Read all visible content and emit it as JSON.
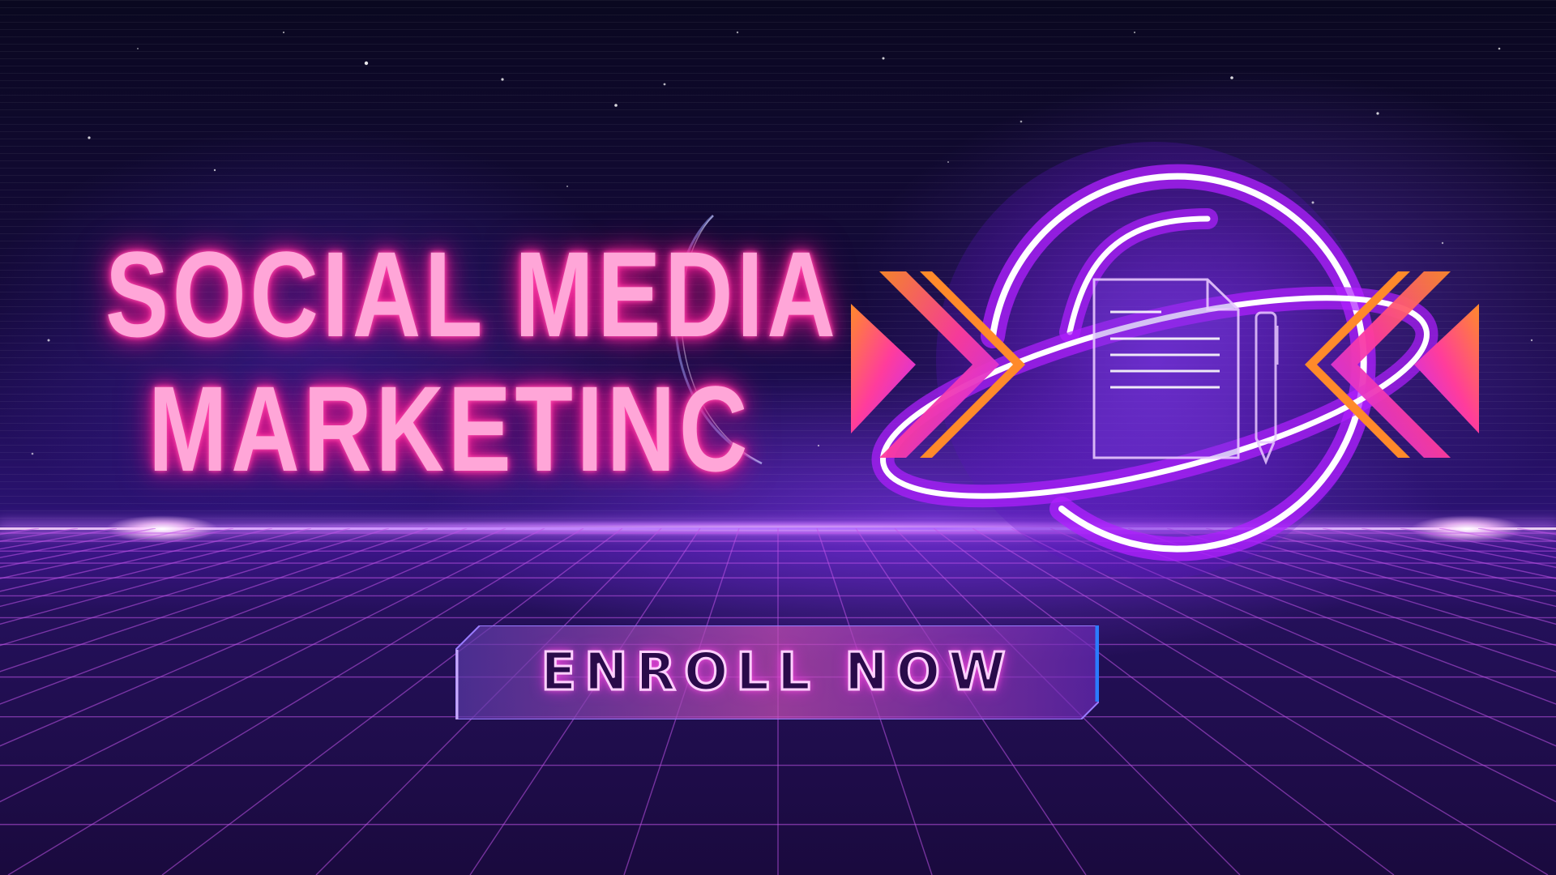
{
  "headline": {
    "line1": "SOCIAL MEDIA",
    "line2": "MARKETINC"
  },
  "cta": {
    "label": "ENROLL NOW"
  },
  "emblem": {
    "icons": [
      "orbit-ring-icon",
      "document-icon",
      "pen-icon",
      "chevron-right-icon",
      "chevron-left-icon"
    ]
  },
  "colors": {
    "headline_text": "#ffa6d8",
    "headline_glow": "#ff2c9c",
    "neon_purple": "#b020ff",
    "neon_core": "#ffffff",
    "grid_line": "#c054e8",
    "chevron_orange": "#ff7a2a",
    "chevron_pink": "#ff3cc8",
    "background_dark": "#0d0424",
    "background_mid": "#2a1270"
  }
}
